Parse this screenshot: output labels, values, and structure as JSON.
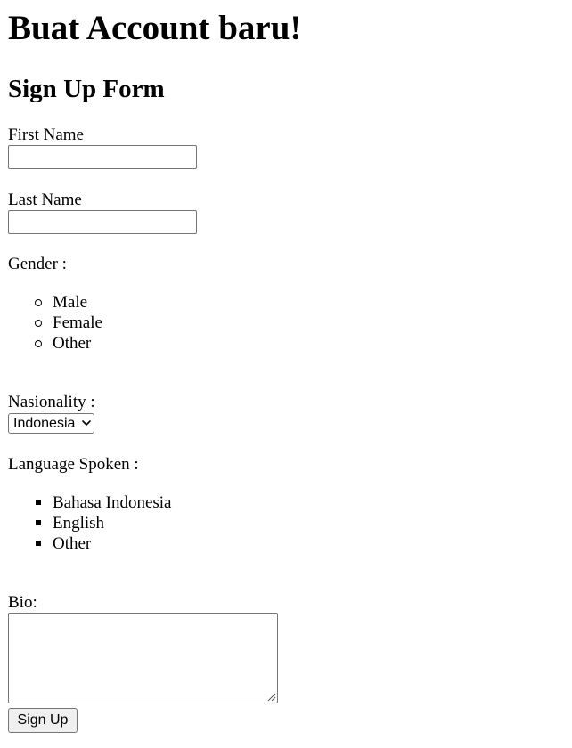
{
  "page": {
    "title": "Buat Account baru!",
    "form_title": "Sign Up Form"
  },
  "first_name": {
    "label": "First Name",
    "value": "",
    "placeholder": ""
  },
  "last_name": {
    "label": "Last Name",
    "value": "",
    "placeholder": ""
  },
  "gender": {
    "label": "Gender :",
    "options": [
      "Male",
      "Female",
      "Other"
    ]
  },
  "nationality": {
    "label": "Nasionality :",
    "selected": "Indonesia"
  },
  "languages": {
    "label": "Language Spoken :",
    "options": [
      "Bahasa Indonesia",
      "English",
      "Other"
    ]
  },
  "bio": {
    "label": "Bio:",
    "value": ""
  },
  "submit": {
    "label": "Sign Up"
  },
  "icons": {
    "gender_bullet": "hollow-circle-bullet",
    "language_bullet": "filled-square-bullet",
    "select_arrow": "chevron-down-icon",
    "resize_grip": "resize-grip-icon"
  }
}
